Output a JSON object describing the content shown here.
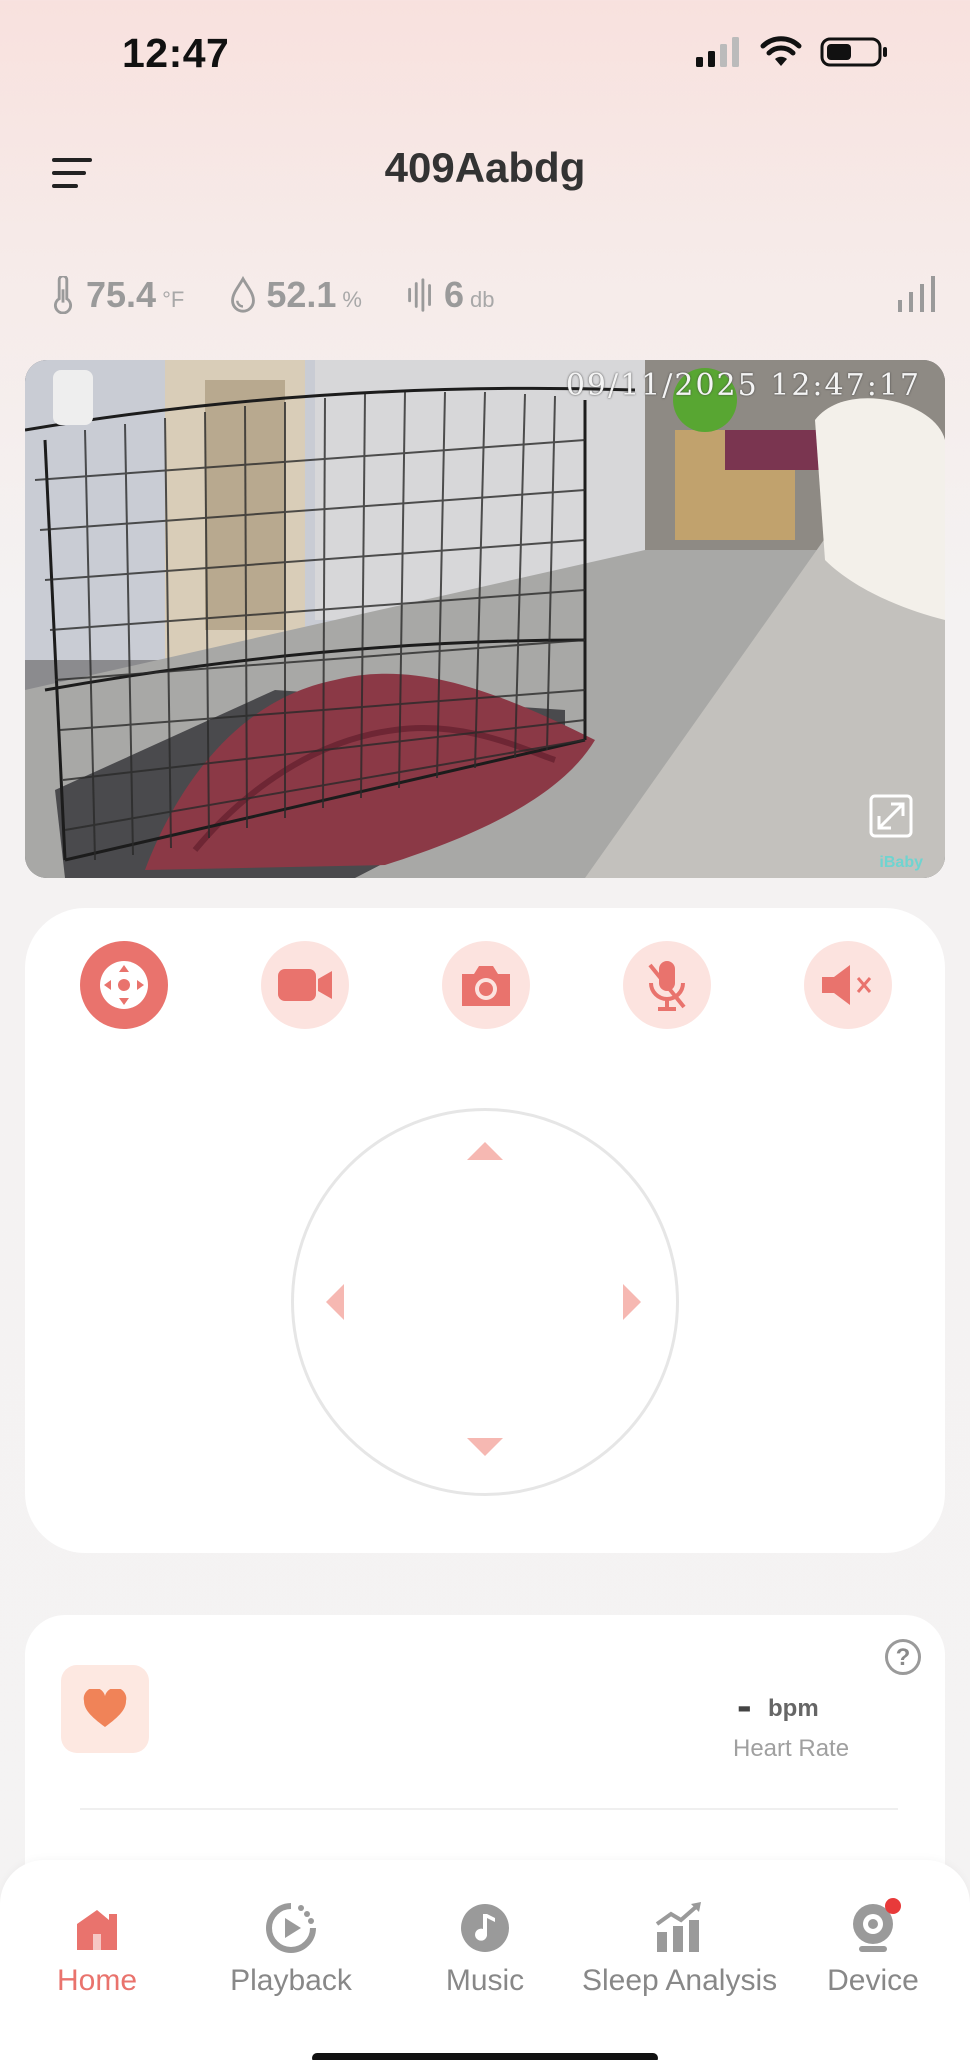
{
  "status_bar": {
    "time": "12:47"
  },
  "header": {
    "title": "409Aabdg"
  },
  "environment": {
    "temperature": {
      "value": "75.4",
      "unit": "°F"
    },
    "humidity": {
      "value": "52.1",
      "unit": "%"
    },
    "sound": {
      "value": "6",
      "unit": "db"
    }
  },
  "camera": {
    "timestamp": "09/11/2025 12:47:17",
    "logo": "iBaby"
  },
  "controls": {
    "buttons": [
      {
        "name": "ptz",
        "icon": "move-icon",
        "active": true
      },
      {
        "name": "record",
        "icon": "video-camera-icon",
        "active": false
      },
      {
        "name": "snapshot",
        "icon": "camera-icon",
        "active": false
      },
      {
        "name": "talk",
        "icon": "microphone-muted-icon",
        "active": false
      },
      {
        "name": "speaker",
        "icon": "speaker-muted-icon",
        "active": false
      }
    ]
  },
  "heart_rate": {
    "value": "-",
    "unit": "bpm",
    "label": "Heart Rate"
  },
  "tabs": [
    {
      "label": "Home",
      "active": true
    },
    {
      "label": "Playback",
      "active": false
    },
    {
      "label": "Music",
      "active": false
    },
    {
      "label": "Sleep Analysis",
      "active": false
    },
    {
      "label": "Device",
      "active": false
    }
  ],
  "colors": {
    "accent": "#e9736d",
    "accent_light": "#fce3df",
    "heart": "#f08358"
  }
}
